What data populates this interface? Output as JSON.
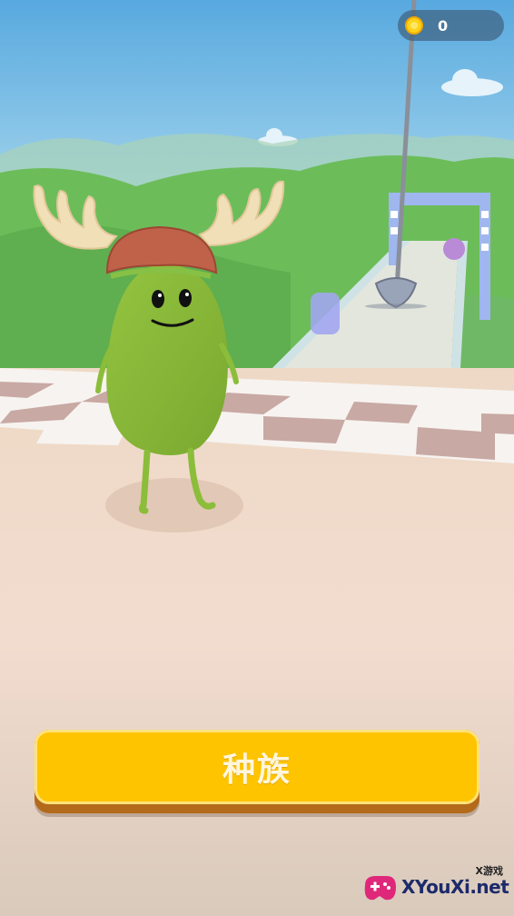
{
  "hud": {
    "coin_icon": "coin-icon",
    "coin_count": "0"
  },
  "main_button": {
    "label": "种族",
    "color": "#ffc400"
  },
  "watermark": {
    "small_text": "X游戏",
    "site_text": "XYouXi.net"
  },
  "colors": {
    "sky_top": "#58a9df",
    "sky_bottom": "#bfe6f4",
    "hills": "#6cbd5a",
    "bean_body": "#8bbd3a",
    "helmet": "#c0624a",
    "antlers": "#f1dfb8",
    "floor": "#e8d3c3",
    "checker_dark": "#c7a7a2"
  }
}
